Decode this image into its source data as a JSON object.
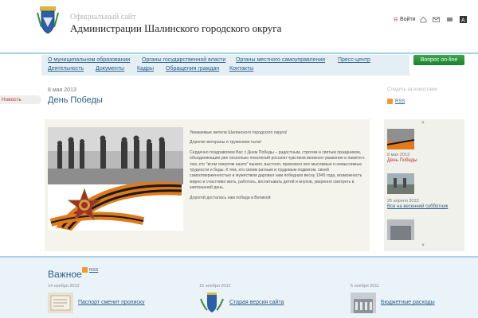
{
  "header": {
    "subtitle": "Официальный сайт",
    "title": "Администрации Шалинского городского округа",
    "login_label": "Войти"
  },
  "nav": {
    "row1": [
      "О муниципальном образовании",
      "Органы государственной власти",
      "Органы местного самоуправления",
      "Пресс-центр"
    ],
    "row2": [
      "Деятельность",
      "Документы",
      "Кадры",
      "Обращения граждан",
      "Контакты"
    ],
    "cta": "Вопрос on-line"
  },
  "article": {
    "tag": "Новость",
    "date": "8 мая 2013",
    "title": "День Победы",
    "paragraphs": [
      "Уважаемые жители Шалинского городского округа!",
      "Дорогие ветераны и труженики тыла!",
      "Сердечно поздравляем Вас с Днем Победы – радостным, строгим и святым праздником, объединяющим уже несколько поколений россиян чувством великого уважения и памяти к тем, кто \"всем смертям назло\" выжил, выстоял, превозмог все мыслимые и немыслимые трудности и беды. К тем, кто своим ратным и трудовым подвигом, своей самоотверженностью и мужеством даровал нам победную весну 1945 года, возможность мирно и счастливо жить, работать, воспитывать детей и внуков, уверенно смотреть в завтрашний день.",
      "Дорогой досталась нам победа в Великой"
    ]
  },
  "sidebar": {
    "label": "Следить за новостями",
    "rss": "RSS",
    "items": [
      {
        "date": "8 мая 2013",
        "title": "День Победы"
      },
      {
        "date": "25 апреля 2013",
        "title": "Все на весенний субботник"
      }
    ]
  },
  "important": {
    "heading": "Важное",
    "rss": "RSS",
    "items": [
      {
        "date": "14 ноября 2012",
        "title": "Паспорт сменит прописку"
      },
      {
        "date": "16 ноября 2012",
        "title": "Старая версия сайта"
      },
      {
        "date": "5 ноября 2011",
        "title": "Бюджетные расходы"
      }
    ]
  },
  "colors": {
    "accent": "#2a5d86",
    "nav_bg": "#e4eff5",
    "cta_green": "#2e9340",
    "rule": "#a9d1e4",
    "panel_bg": "#f4f3ec"
  }
}
